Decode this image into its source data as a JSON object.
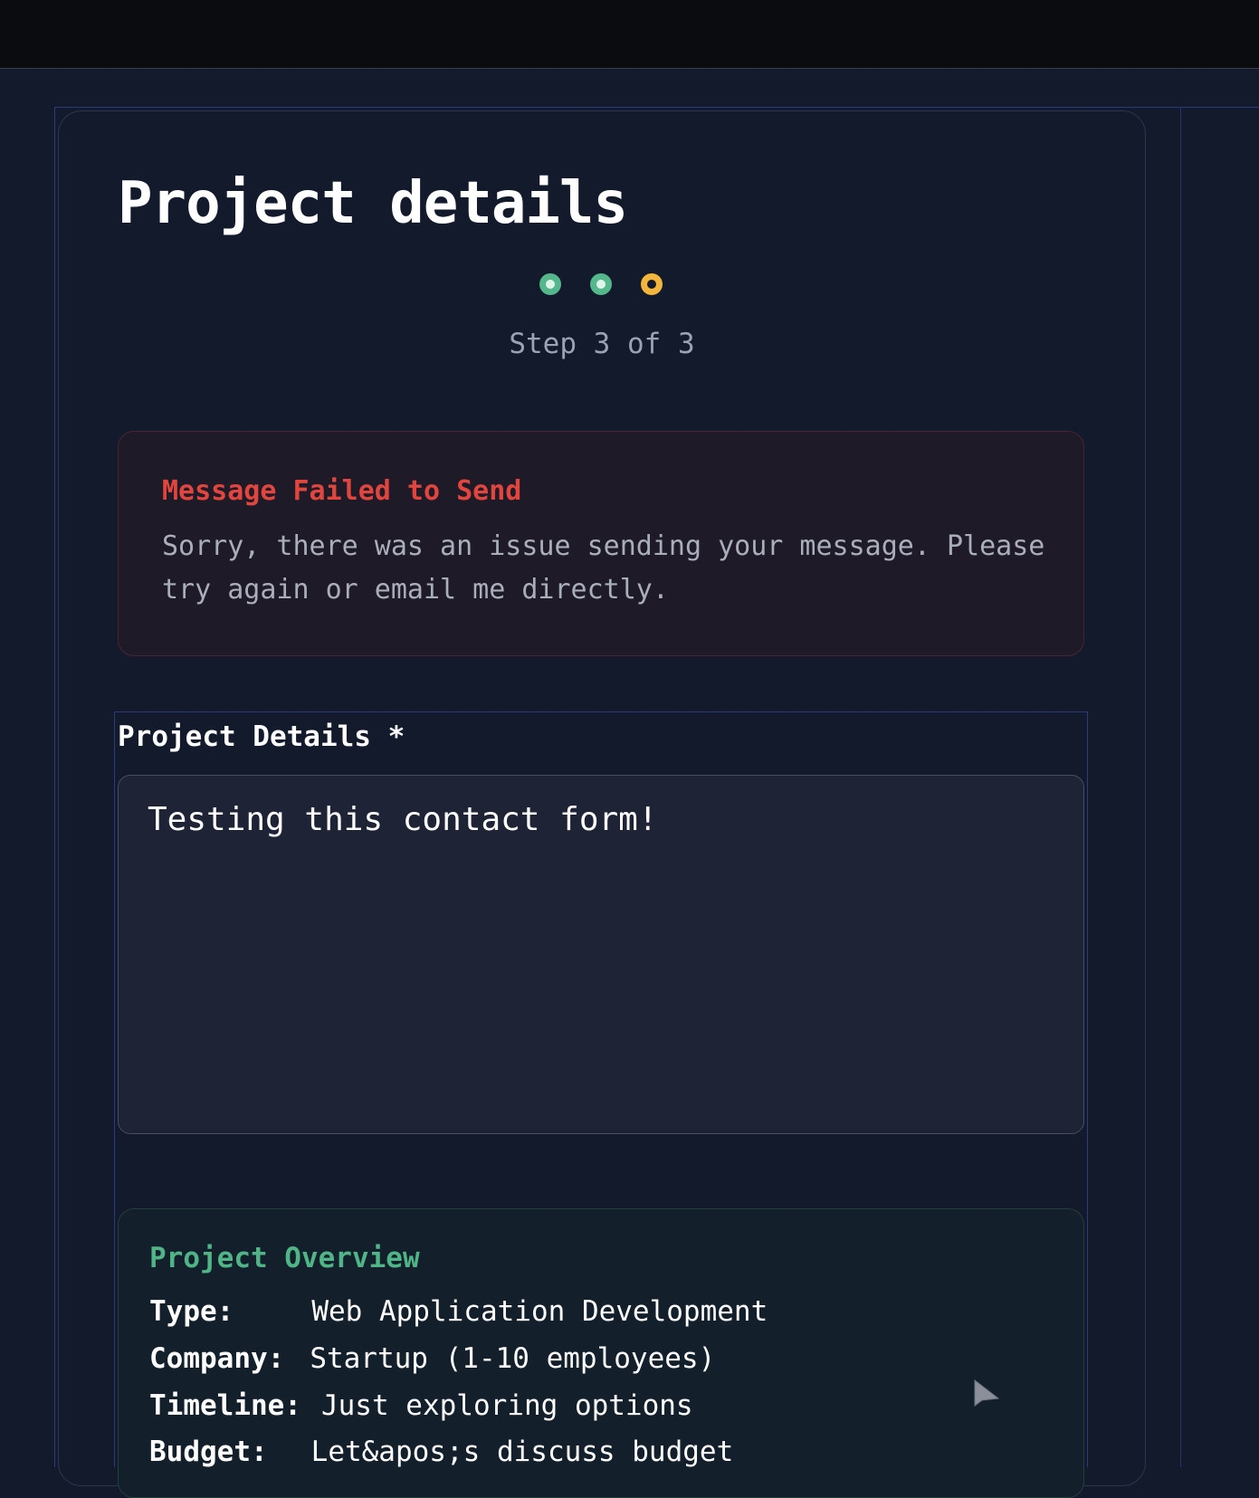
{
  "page": {
    "title": "Project details"
  },
  "stepper": {
    "label": "Step 3 of 3",
    "steps": [
      {
        "state": "complete"
      },
      {
        "state": "complete"
      },
      {
        "state": "current"
      }
    ],
    "colors": {
      "complete": "#55b78c",
      "current": "#f2b63c"
    }
  },
  "error": {
    "title": "Message Failed to Send",
    "message": "Sorry, there was an issue sending your message. Please try again or email me directly.",
    "color": "#e0453e"
  },
  "form": {
    "project_details_label": "Project Details *",
    "project_details_value": "Testing this contact form!"
  },
  "overview": {
    "title": "Project Overview",
    "color": "#4fb486",
    "rows": [
      {
        "key": "Type:",
        "value": "Web Application Development"
      },
      {
        "key": "Company:",
        "value": "Startup (1-10 employees)"
      },
      {
        "key": "Timeline:",
        "value": "Just exploring options"
      },
      {
        "key": "Budget:",
        "value": "Let&apos;s discuss budget"
      }
    ]
  },
  "icons": {
    "cursor": "pointer-cursor-icon"
  }
}
